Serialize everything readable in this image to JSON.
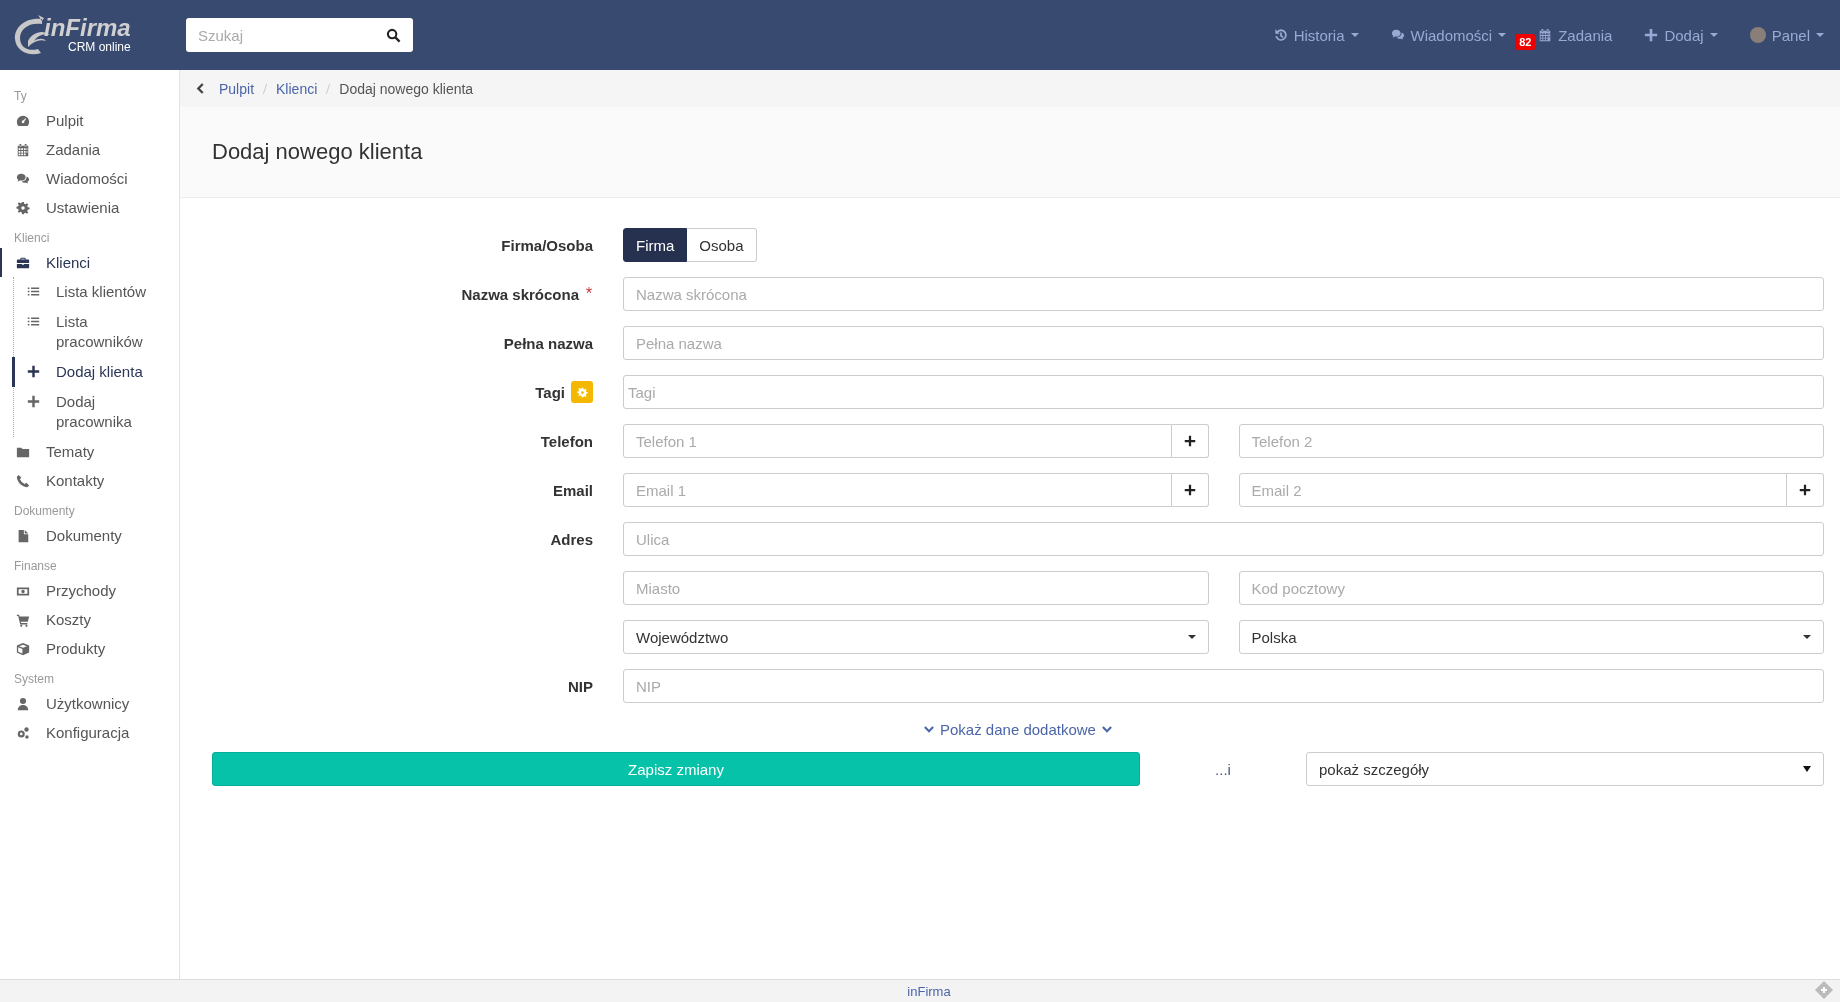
{
  "header": {
    "logo": {
      "name": "inFirma",
      "subtitle": "CRM online"
    },
    "search": {
      "placeholder": "Szukaj"
    },
    "nav": [
      {
        "label": "Historia",
        "dropdown": true
      },
      {
        "label": "Wiadomości",
        "dropdown": true
      },
      {
        "label": "Zadania",
        "dropdown": false,
        "badge": "82"
      },
      {
        "label": "Dodaj",
        "dropdown": true
      },
      {
        "label": "Panel",
        "dropdown": true
      }
    ]
  },
  "sidebar": {
    "sections": [
      {
        "title": "Ty",
        "items": [
          {
            "label": "Pulpit",
            "selected": false
          },
          {
            "label": "Zadania",
            "selected": false
          },
          {
            "label": "Wiadomości",
            "selected": false
          },
          {
            "label": "Ustawienia",
            "selected": false
          }
        ]
      },
      {
        "title": "Klienci",
        "items": [
          {
            "label": "Klienci",
            "selected": true,
            "expanded": true,
            "children": [
              {
                "label": "Lista klientów",
                "selected": false
              },
              {
                "label": "Lista pracowników",
                "selected": false
              },
              {
                "label": "Dodaj klienta",
                "selected": true
              },
              {
                "label": "Dodaj pracownika",
                "selected": false
              }
            ]
          },
          {
            "label": "Tematy",
            "selected": false
          },
          {
            "label": "Kontakty",
            "selected": false
          }
        ]
      },
      {
        "title": "Dokumenty",
        "items": [
          {
            "label": "Dokumenty",
            "selected": false
          }
        ]
      },
      {
        "title": "Finanse",
        "items": [
          {
            "label": "Przychody",
            "selected": false
          },
          {
            "label": "Koszty",
            "selected": false
          },
          {
            "label": "Produkty",
            "selected": false
          }
        ]
      },
      {
        "title": "System",
        "items": [
          {
            "label": "Użytkownicy",
            "selected": false
          },
          {
            "label": "Konfiguracja",
            "selected": false
          }
        ]
      }
    ]
  },
  "breadcrumb": [
    {
      "label": "Pulpit",
      "link": true
    },
    {
      "label": "Klienci",
      "link": true
    },
    {
      "label": "Dodaj nowego klienta",
      "link": false
    }
  ],
  "page": {
    "title": "Dodaj nowego klienta"
  },
  "form": {
    "rows": [
      {
        "kind": "toggle",
        "label": "Firma/Osoba",
        "options": [
          {
            "label": "Firma",
            "selected": true
          },
          {
            "label": "Osoba",
            "selected": false
          }
        ]
      },
      {
        "kind": "text",
        "label": "Nazwa skrócona",
        "required": true,
        "placeholder": "Nazwa skrócona"
      },
      {
        "kind": "text",
        "label": "Pełna nazwa",
        "required": false,
        "placeholder": "Pełna nazwa"
      },
      {
        "kind": "tags",
        "label": "Tagi",
        "placeholder": "Tagi"
      },
      {
        "kind": "pair",
        "label": "Telefon",
        "fields": [
          {
            "placeholder": "Telefon 1",
            "add_button": true
          },
          {
            "placeholder": "Telefon 2",
            "add_button": false
          }
        ]
      },
      {
        "kind": "pair",
        "label": "Email",
        "fields": [
          {
            "placeholder": "Email 1",
            "add_button": true
          },
          {
            "placeholder": "Email 2",
            "add_button": true
          }
        ]
      },
      {
        "kind": "address",
        "label": "Adres",
        "street": {
          "placeholder": "Ulica"
        },
        "city": {
          "placeholder": "Miasto"
        },
        "postal": {
          "placeholder": "Kod pocztowy"
        },
        "region": {
          "value": "Województwo"
        },
        "country": {
          "value": "Polska"
        }
      },
      {
        "kind": "text",
        "label": "NIP",
        "required": false,
        "placeholder": "NIP"
      }
    ],
    "more_link": "Pokaż dane dodatkowe",
    "save_button": "Zapisz zmiany",
    "and_text": "...i",
    "after_save": {
      "value": "pokaż szczegóły"
    }
  },
  "footer": {
    "text": "inFirma"
  }
}
